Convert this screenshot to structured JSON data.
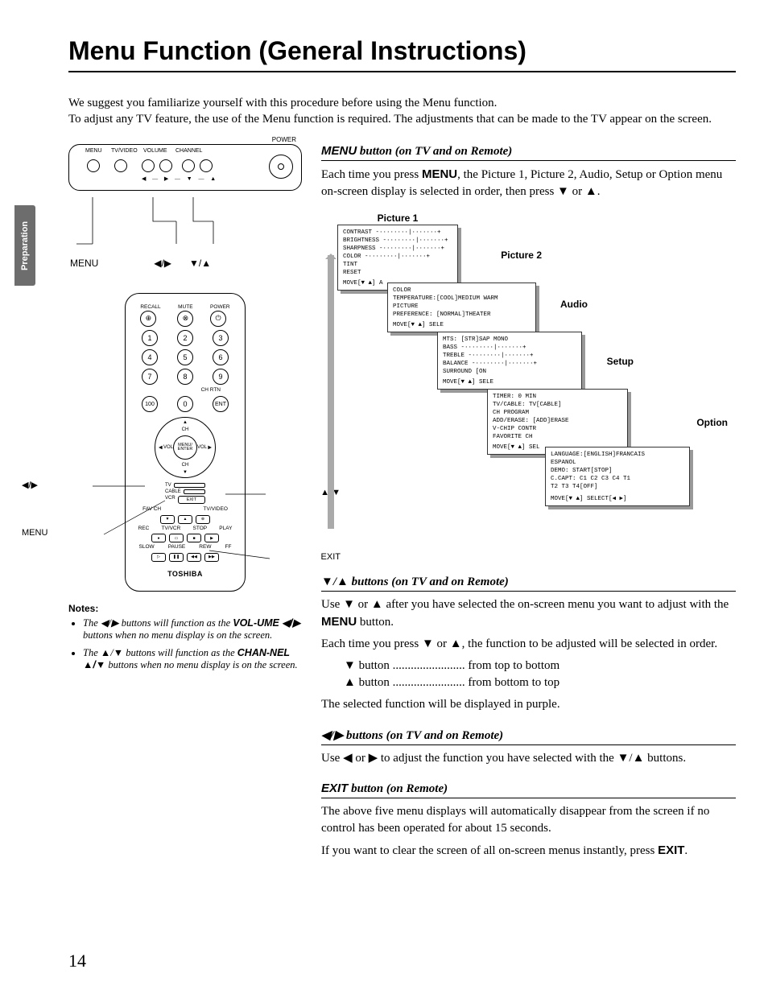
{
  "sidebar": "Preparation",
  "title": "Menu Function (General Instructions)",
  "intro1": "We suggest you familiarize yourself with this procedure before using the Menu function.",
  "intro2": "To adjust any TV feature, the use of the Menu function is required. The adjustments that can be made to the TV appear on the screen.",
  "tvpanel": {
    "labels": [
      "MENU",
      "TV/VIDEO",
      "VOLUME",
      "CHANNEL"
    ],
    "power": "POWER",
    "ann_menu": "MENU",
    "ann_lr": "◀/▶",
    "ann_ud": "▼/▲"
  },
  "remote": {
    "top": {
      "recall": "RECALL",
      "mute": "MUTE",
      "power": "POWER"
    },
    "numrows": [
      [
        "1",
        "2",
        "3"
      ],
      [
        "4",
        "5",
        "6"
      ],
      [
        "7",
        "8",
        "9"
      ],
      [
        "100",
        "0",
        "ENT"
      ]
    ],
    "chrtn": "CH RTN",
    "nav": {
      "center": "MENU/\nENTER",
      "ch": "CH",
      "vol": "VOL"
    },
    "slider": [
      "TV",
      "CABLE",
      "VCR"
    ],
    "exit": "EXIT",
    "favrow_lbl": [
      "FAV CH",
      "",
      "TV/VIDEO"
    ],
    "row1_lbl": [
      "REC",
      "TV/VCR",
      "STOP",
      "PLAY"
    ],
    "row2_lbl": [
      "SLOW",
      "PAUSE",
      "REW",
      "FF"
    ],
    "brand": "TOSHIBA",
    "ann": {
      "menu": "MENU",
      "lr": "◀/▶",
      "ud": "▲/▼",
      "exit": "EXIT"
    }
  },
  "notes": {
    "heading": "Notes:",
    "n1a": "The ◀/▶ buttons will function as the ",
    "n1b": "VOL-UME ◀/▶",
    "n1c": " buttons when no menu display is on the screen.",
    "n2a": "The ▲/▼ buttons will function as the ",
    "n2b": "CHAN-NEL ▲/▼",
    "n2c": " buttons when no menu display is on the screen."
  },
  "sect_menu": {
    "h_kw": "MENU",
    "h_rest": " button (on TV and on Remote)",
    "p1a": "Each time you press ",
    "p1kw": "MENU",
    "p1b": ", the Picture 1, Picture 2, Audio, Setup or Option menu on-screen display is selected in order, then press ▼ or ▲."
  },
  "cascade": {
    "p1": {
      "title": "Picture 1",
      "rows": [
        "CONTRAST   -········|·······+",
        "BRIGHTNESS -········|·······+",
        "SHARPNESS  -········|·······+",
        "COLOR      -········|·······+",
        "TINT",
        "RESET"
      ],
      "foot": "MOVE[▼ ▲]  A"
    },
    "p2": {
      "title": "Picture 2",
      "rows": [
        "COLOR",
        " TEMPERATURE:[COOL]MEDIUM WARM",
        "PICTURE",
        " PREFERENCE: [NORMAL]THEATER"
      ],
      "foot": "MOVE[▼ ▲] SELE"
    },
    "audio": {
      "title": "Audio",
      "rows": [
        "MTS:       [STR]SAP MONO",
        "BASS      -········|·······+",
        "TREBLE    -········|·······+",
        "BALANCE   -········|·······+",
        "SURROUND  [ON"
      ],
      "foot": "MOVE[▼ ▲] SELE"
    },
    "setup": {
      "title": "Setup",
      "rows": [
        "TIMER:         0 MIN",
        "TV/CABLE:     TV[CABLE]",
        "CH PROGRAM",
        "ADD/ERASE:   [ADD]ERASE",
        "V-CHIP CONTR",
        "FAVORITE CH"
      ],
      "foot": "MOVE[▼ ▲] SEL"
    },
    "option": {
      "title": "Option",
      "rows": [
        "LANGUAGE:[ENGLISH]FRANCAIS",
        "          ESPANOL",
        "DEMO:     START[STOP]",
        "C.CAPT:   C1 C2 C3 C4 T1",
        "          T2 T3 T4[OFF]"
      ],
      "foot": "MOVE[▼ ▲] SELECT[◀ ▶]"
    }
  },
  "sect_ud": {
    "h": "▼/▲ buttons (on TV and on Remote)",
    "p1a": "Use ▼ or ▲ after you have selected the on-screen menu you want to adjust with the ",
    "p1kw": "MENU",
    "p1b": " button.",
    "p2": "Each time you press ▼ or ▲, the function to be adjusted will be selected in order.",
    "l1": "▼ button ........................ from top to bottom",
    "l2": "▲ button ........................ from bottom to top",
    "p3": "The selected function will be displayed in purple."
  },
  "sect_lr": {
    "h": "◀/▶ buttons (on TV and on Remote)",
    "p": "Use ◀ or ▶ to adjust the function you have selected with the ▼/▲ buttons."
  },
  "sect_exit": {
    "h_kw": "EXIT",
    "h_rest": " button (on Remote)",
    "p1": "The above five menu displays will automatically disappear from the screen if no control has been operated for about 15 seconds.",
    "p2a": "If you want to clear the screen of all on-screen menus instantly, press ",
    "p2kw": "EXIT",
    "p2b": "."
  },
  "pagenum": "14"
}
